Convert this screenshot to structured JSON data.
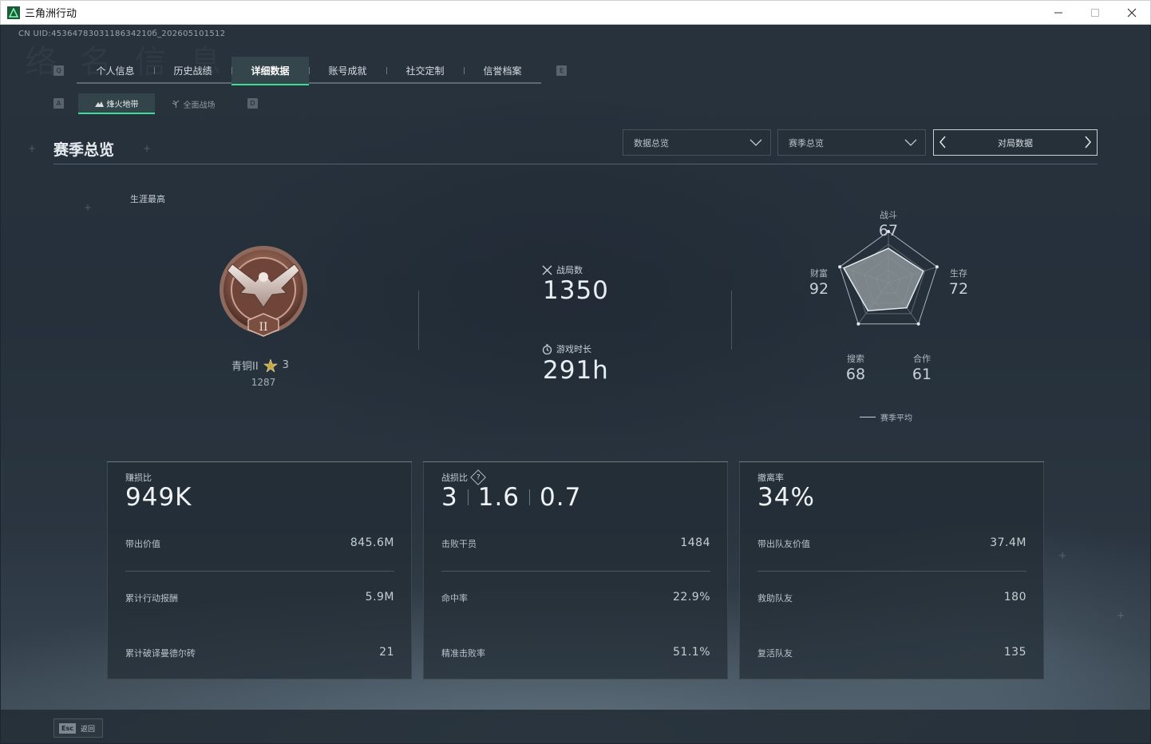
{
  "window": {
    "title": "三角洲行动",
    "minimize": "—",
    "maximize": "☐",
    "close": "✕"
  },
  "uid": "CN UID:4536478303118634210б_202605101512",
  "watermark": "络 名 信 息",
  "nav": {
    "key_left": "Q",
    "key_right": "E",
    "tabs": [
      {
        "label": "个人信息"
      },
      {
        "label": "历史战绩"
      },
      {
        "label": "详细数据",
        "active": true
      },
      {
        "label": "账号成就"
      },
      {
        "label": "社交定制"
      },
      {
        "label": "信誉档案"
      }
    ],
    "sub_key_left": "A",
    "sub_key_right": "D",
    "subtabs": [
      {
        "label": "烽火地带",
        "icon": "mountain-icon",
        "active": true
      },
      {
        "label": "全面战场",
        "icon": "antenna-icon"
      }
    ]
  },
  "section": {
    "title": "赛季总览",
    "dropdown1": "数据总览",
    "dropdown2": "赛季总览",
    "pager_label": "对局数据"
  },
  "rank": {
    "caption": "生涯最高",
    "name": "青铜II",
    "stars": "3",
    "score": "1287",
    "medal_numeral": "II"
  },
  "stats": {
    "matches_label": "战局数",
    "matches_value": "1350",
    "playtime_label": "游戏时长",
    "playtime_value": "291h"
  },
  "radar": {
    "axes": [
      {
        "label": "战斗",
        "value": "67"
      },
      {
        "label": "生存",
        "value": "72"
      },
      {
        "label": "合作",
        "value": "61"
      },
      {
        "label": "搜索",
        "value": "68"
      },
      {
        "label": "财富",
        "value": "92"
      }
    ],
    "legend": "赛季平均",
    "fill_color": "#8c9499"
  },
  "cards": [
    {
      "label": "赚损比",
      "big": [
        "949K"
      ],
      "rows": [
        {
          "label": "带出价值",
          "value": "845.6M"
        },
        {
          "label": "累计行动报酬",
          "value": "5.9M"
        },
        {
          "label": "累计破译曼德尔砖",
          "value": "21"
        }
      ]
    },
    {
      "label": "战损比",
      "help": "?",
      "big": [
        "3",
        "1.6",
        "0.7"
      ],
      "rows": [
        {
          "label": "击败干员",
          "value": "1484"
        },
        {
          "label": "命中率",
          "value": "22.9%"
        },
        {
          "label": "精准击败率",
          "value": "51.1%"
        }
      ]
    },
    {
      "label": "撤离率",
      "big": [
        "34%"
      ],
      "rows": [
        {
          "label": "带出队友价值",
          "value": "37.4M"
        },
        {
          "label": "救助队友",
          "value": "180"
        },
        {
          "label": "复活队友",
          "value": "135"
        }
      ]
    }
  ],
  "bottom": {
    "esc_key": "Esc",
    "back_label": "返回"
  },
  "colors": {
    "accent": "#3ddc97",
    "background": "#25303b"
  }
}
